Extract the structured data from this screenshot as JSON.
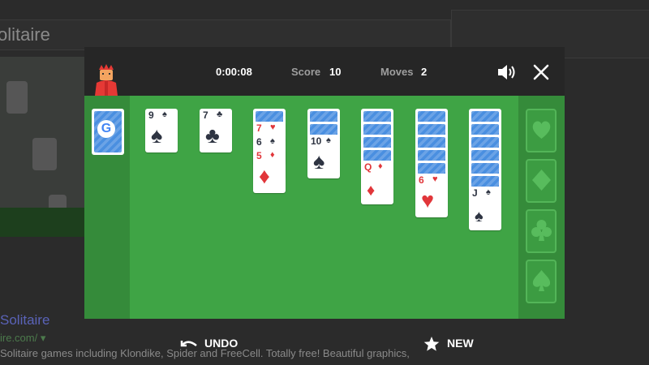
{
  "background_page": {
    "title": "olitaire",
    "result_title": "Solitaire",
    "result_url": "ire.com/ ▾",
    "result_desc": "Solitaire games including Klondike, Spider and FreeCell. Totally free! Beautiful graphics,"
  },
  "header": {
    "time": "0:00:08",
    "score_label": "Score",
    "score": "10",
    "moves_label": "Moves",
    "moves": "2"
  },
  "controls": {
    "sound_icon": "volume-icon",
    "close_icon": "close-icon"
  },
  "stock": {
    "logo": "G"
  },
  "tableau": [
    {
      "hidden": 0,
      "cards": [
        {
          "rank": "9",
          "suit": "♠",
          "color": "black"
        }
      ]
    },
    {
      "hidden": 0,
      "cards": [
        {
          "rank": "7",
          "suit": "♣",
          "color": "black"
        }
      ]
    },
    {
      "hidden": 1,
      "cards": [
        {
          "rank": "7",
          "suit": "♥",
          "color": "red"
        },
        {
          "rank": "6",
          "suit": "♠",
          "color": "black"
        },
        {
          "rank": "5",
          "suit": "♦",
          "color": "red"
        }
      ]
    },
    {
      "hidden": 2,
      "cards": [
        {
          "rank": "10",
          "suit": "♠",
          "color": "black"
        }
      ]
    },
    {
      "hidden": 4,
      "cards": [
        {
          "rank": "Q",
          "suit": "♦",
          "color": "red"
        }
      ]
    },
    {
      "hidden": 5,
      "cards": [
        {
          "rank": "6",
          "suit": "♥",
          "color": "red"
        }
      ]
    },
    {
      "hidden": 6,
      "cards": [
        {
          "rank": "J",
          "suit": "♠",
          "color": "black"
        }
      ]
    }
  ],
  "foundations": [
    {
      "suit": "♥",
      "icon": "heart-icon"
    },
    {
      "suit": "♦",
      "icon": "diamond-icon"
    },
    {
      "suit": "♣",
      "icon": "club-icon"
    },
    {
      "suit": "♠",
      "icon": "spade-icon"
    }
  ],
  "actions": {
    "undo_label": "UNDO",
    "new_label": "NEW"
  },
  "colors": {
    "felt": "#3fa445",
    "felt_dark": "#358b3a",
    "card_back": "#4a8fe0",
    "red_suit": "#e1363a",
    "black_suit": "#2e3442"
  }
}
